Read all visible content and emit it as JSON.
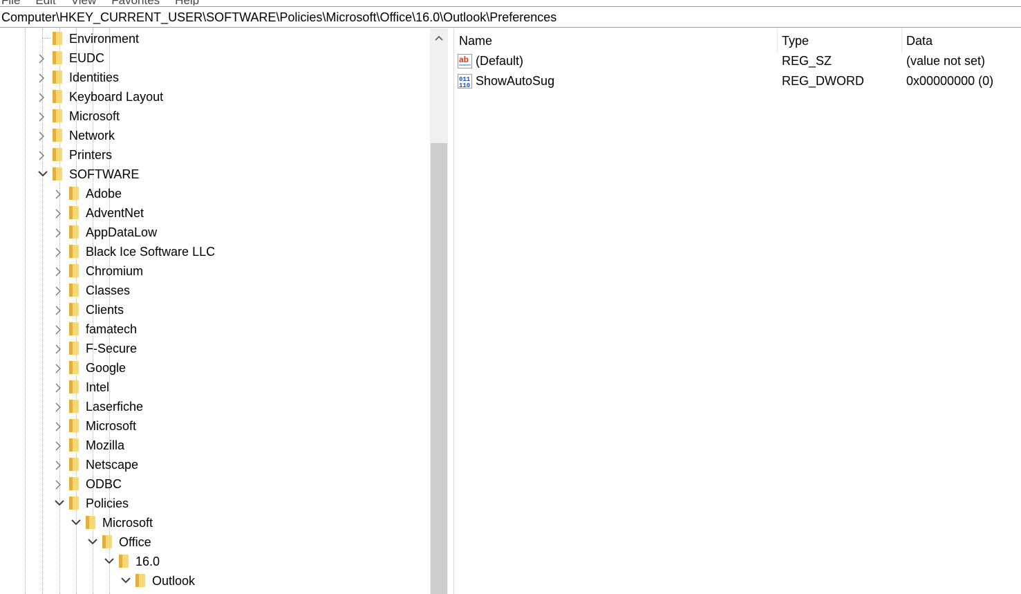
{
  "menu": [
    "File",
    "Edit",
    "View",
    "Favorites",
    "Help"
  ],
  "address": "Computer\\HKEY_CURRENT_USER\\SOFTWARE\\Policies\\Microsoft\\Office\\16.0\\Outlook\\Preferences",
  "tree": {
    "items": [
      {
        "label": "Environment",
        "depth": 0,
        "state": "none"
      },
      {
        "label": "EUDC",
        "depth": 0,
        "state": "collapsed"
      },
      {
        "label": "Identities",
        "depth": 0,
        "state": "collapsed"
      },
      {
        "label": "Keyboard Layout",
        "depth": 0,
        "state": "collapsed"
      },
      {
        "label": "Microsoft",
        "depth": 0,
        "state": "collapsed"
      },
      {
        "label": "Network",
        "depth": 0,
        "state": "collapsed"
      },
      {
        "label": "Printers",
        "depth": 0,
        "state": "collapsed"
      },
      {
        "label": "SOFTWARE",
        "depth": 0,
        "state": "expanded"
      },
      {
        "label": "Adobe",
        "depth": 1,
        "state": "collapsed"
      },
      {
        "label": "AdventNet",
        "depth": 1,
        "state": "collapsed"
      },
      {
        "label": "AppDataLow",
        "depth": 1,
        "state": "collapsed"
      },
      {
        "label": "Black Ice Software LLC",
        "depth": 1,
        "state": "collapsed"
      },
      {
        "label": "Chromium",
        "depth": 1,
        "state": "collapsed"
      },
      {
        "label": "Classes",
        "depth": 1,
        "state": "collapsed"
      },
      {
        "label": "Clients",
        "depth": 1,
        "state": "collapsed"
      },
      {
        "label": "famatech",
        "depth": 1,
        "state": "collapsed"
      },
      {
        "label": "F-Secure",
        "depth": 1,
        "state": "collapsed"
      },
      {
        "label": "Google",
        "depth": 1,
        "state": "collapsed"
      },
      {
        "label": "Intel",
        "depth": 1,
        "state": "collapsed"
      },
      {
        "label": "Laserfiche",
        "depth": 1,
        "state": "collapsed"
      },
      {
        "label": "Microsoft",
        "depth": 1,
        "state": "collapsed"
      },
      {
        "label": "Mozilla",
        "depth": 1,
        "state": "collapsed"
      },
      {
        "label": "Netscape",
        "depth": 1,
        "state": "collapsed"
      },
      {
        "label": "ODBC",
        "depth": 1,
        "state": "collapsed"
      },
      {
        "label": "Policies",
        "depth": 1,
        "state": "expanded"
      },
      {
        "label": "Microsoft",
        "depth": 2,
        "state": "expanded"
      },
      {
        "label": "Office",
        "depth": 3,
        "state": "expanded"
      },
      {
        "label": "16.0",
        "depth": 4,
        "state": "expanded"
      },
      {
        "label": "Outlook",
        "depth": 5,
        "state": "expanded"
      }
    ]
  },
  "values": {
    "headers": {
      "name": "Name",
      "type": "Type",
      "data": "Data"
    },
    "rows": [
      {
        "name": "(Default)",
        "type": "REG_SZ",
        "data": "(value not set)",
        "icon": "reg-string-icon"
      },
      {
        "name": "ShowAutoSug",
        "type": "REG_DWORD",
        "data": "0x00000000 (0)",
        "icon": "reg-binary-icon"
      }
    ]
  },
  "colors": {
    "folder": "#f8d775",
    "folder_dark": "#e0b040",
    "chevron": "#8a8a8a",
    "scroll_thumb": "#cdcdcd"
  }
}
